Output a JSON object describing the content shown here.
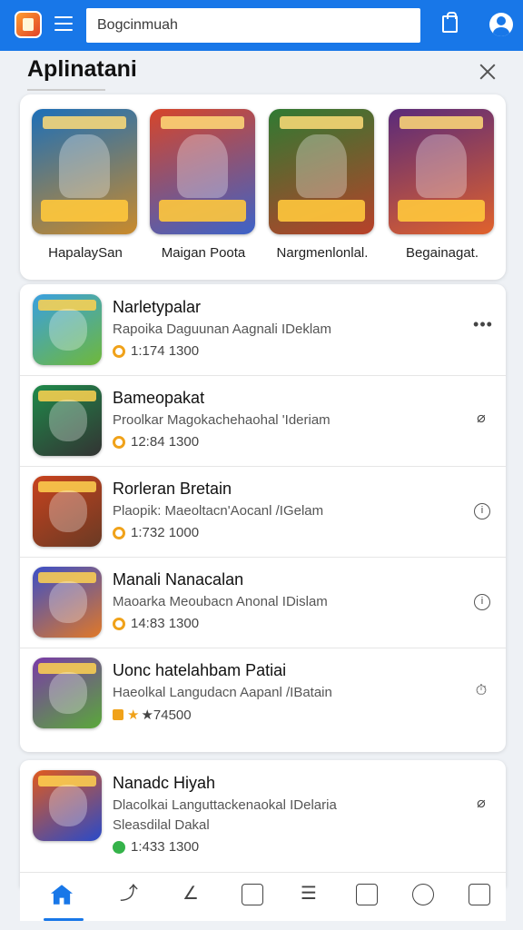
{
  "header": {
    "search_value": "Bogcinmuah",
    "icons": [
      "app-logo-icon",
      "menu-icon",
      "bag-icon",
      "profile-icon"
    ]
  },
  "page": {
    "title": "Aplinatani"
  },
  "featured": [
    {
      "label": "HapalaySan",
      "colors": [
        "#1d6fb8",
        "#c98a2b"
      ]
    },
    {
      "label": "Maigan Poota",
      "colors": [
        "#d6452a",
        "#3d63c8"
      ]
    },
    {
      "label": "Nargmenlonlal.",
      "colors": [
        "#2f7a32",
        "#b8412a"
      ]
    },
    {
      "label": "Begainagat.",
      "colors": [
        "#5a2a7a",
        "#e0622c"
      ]
    }
  ],
  "apps": [
    {
      "title": "Narletypalar",
      "subtitle": "Rapoika Daguunan Aagnali IDeklam",
      "meta": "1:174 1300",
      "meta_type": "ring",
      "action": "more-icon",
      "colors": [
        "#3aa0e0",
        "#6fb83a"
      ]
    },
    {
      "title": "Bameopakat",
      "subtitle": "Proolkar Magokachehaohal 'Ideriam",
      "meta": "12:84 1300",
      "meta_type": "ring",
      "action": "pin-icon",
      "colors": [
        "#1f8a4a",
        "#333"
      ]
    },
    {
      "title": "Rorleran Bretain",
      "subtitle": "Plaopik: Maeoltacn'Aocanl /IGelam",
      "meta": "1:732 1000",
      "meta_type": "ring",
      "action": "info-icon",
      "colors": [
        "#c8421e",
        "#6a3a24"
      ]
    },
    {
      "title": "Manali Nanacalan",
      "subtitle": "Maoarka Meoubacn Anonal IDislam",
      "meta": "14:83 1300",
      "meta_type": "ring",
      "action": "info-icon",
      "colors": [
        "#3b4fc8",
        "#e07828"
      ]
    },
    {
      "title": "Uonc hatelahbam Patiai",
      "subtitle": "Haeolkal Langudacn Aapanl /IBatain",
      "meta": "★74500",
      "meta_type": "stars",
      "action": "timer-icon",
      "colors": [
        "#7a3aa8",
        "#5aa83a"
      ]
    },
    {
      "title": "Nanadc Hiyah",
      "subtitle": "Dlacolkai Languttackenaokal IDelaria",
      "subtitle2": "Sleasdilal Dakal",
      "meta": "1:433 1300",
      "meta_type": "green",
      "action": "pin-icon",
      "colors": [
        "#e05a1e",
        "#2a4ac8"
      ]
    }
  ],
  "nav": [
    "home-icon",
    "link-icon",
    "shape-icon",
    "store-icon",
    "list-icon",
    "chart-icon",
    "person-icon",
    "puzzle-icon"
  ]
}
